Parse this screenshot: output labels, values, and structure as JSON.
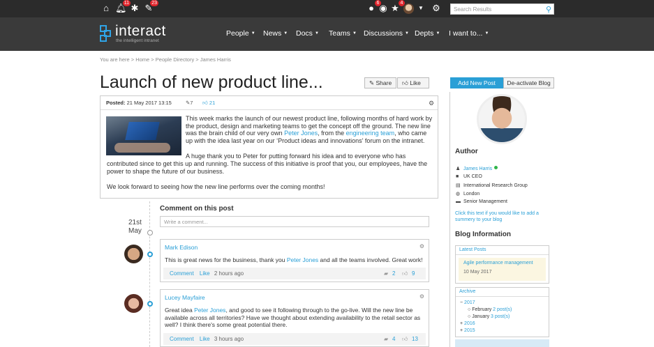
{
  "topbar": {
    "notif_count": "11",
    "tasks_count": "23",
    "alerts_count": "6",
    "fav_count": "4",
    "search_placeholder": "Search Results"
  },
  "logo": {
    "name": "interact",
    "tagline": "the intelligent intranet"
  },
  "nav": [
    {
      "label": "People"
    },
    {
      "label": "News"
    },
    {
      "label": "Docs"
    },
    {
      "label": "Teams"
    },
    {
      "label": "Discussions"
    },
    {
      "label": "Depts"
    },
    {
      "label": "I want to..."
    }
  ],
  "breadcrumb": "You are here > Home > People Directory > James Harris",
  "page_title": "Launch of new product line...",
  "actions": {
    "share": "Share",
    "like": "Like",
    "add_post": "Add New Post",
    "deactivate": "De-activate Blog"
  },
  "post": {
    "posted_label": "Posted:",
    "posted_date": "21 May 2017 13:15",
    "edits": "7",
    "likes": "21",
    "p1_a": "This week marks the launch of our newest product line, following months of hard work by",
    "p1_b": "the product, design and marketing teams to get the concept off the ground. The new line",
    "p1_c_pre": "was the brain child of our very own ",
    "p1_c_link1": "Peter Jones",
    "p1_c_mid": ", from the ",
    "p1_c_link2": "engineering team",
    "p1_c_post": ", who came",
    "p1_d": "up with the idea last year on our ‘Product ideas and innovations’ forum on the intranet.",
    "p2_a": "A huge thank you to Peter for putting forward his idea and to everyone who has",
    "p2_b": "contributed since to get this up and running. The success of this initiative is proof that you, our employees, have the",
    "p2_c": "power to shape the future of our business.",
    "p3": "We look forward to seeing how the new line performs over the coming months!"
  },
  "comments_section": {
    "heading": "Comment on this post",
    "placeholder": "Write a comment...",
    "date_day": "21st",
    "date_month": "May"
  },
  "comments": [
    {
      "name": "Mark Edison",
      "text_pre": "This is great news for the business, thank you ",
      "text_link": "Peter Jones",
      "text_post": " and all the teams involved. Great work!",
      "comment_label": "Comment",
      "like_label": "Like",
      "time": "2 hours ago",
      "replies": "2",
      "likes": "9"
    },
    {
      "name": "Lucey Mayfaire",
      "line1_pre": "Great idea ",
      "line1_link": "Peter Jones",
      "line1_post": ", and good to see it following through to the go-live. Will the new line be",
      "line2": "available across all territories? Have we thought about extending availability to the retail sector as",
      "line3": "well? I think there's some great potential there.",
      "comment_label": "Comment",
      "like_label": "Like",
      "time": "3 hours ago",
      "replies": "4",
      "likes": "13"
    }
  ],
  "author": {
    "heading": "Author",
    "name": "James Harris",
    "role": "UK CEO",
    "company": "International Research Group",
    "location": "London",
    "team": "Senior Management",
    "summary_note": "Click this text if you would like to add a summery to your blog"
  },
  "blog_info": {
    "heading": "Blog Information",
    "latest_posts_label": "Latest Posts",
    "latest_post_title": "Agile performance management",
    "latest_post_date": "10 May 2017",
    "archive_label": "Archive",
    "archive": {
      "year_2017": "2017",
      "feb_label": "February",
      "feb_count": "2 post(s)",
      "jan_label": "January",
      "jan_count": "3 post(s)",
      "year_2016": "2016",
      "year_2015": "2015"
    }
  },
  "colors": {
    "accent": "#2a9fd6",
    "topbar": "#2b2b2b",
    "navbar": "#3a3a3a",
    "badge": "#e0242b",
    "online": "#2fb44a"
  }
}
